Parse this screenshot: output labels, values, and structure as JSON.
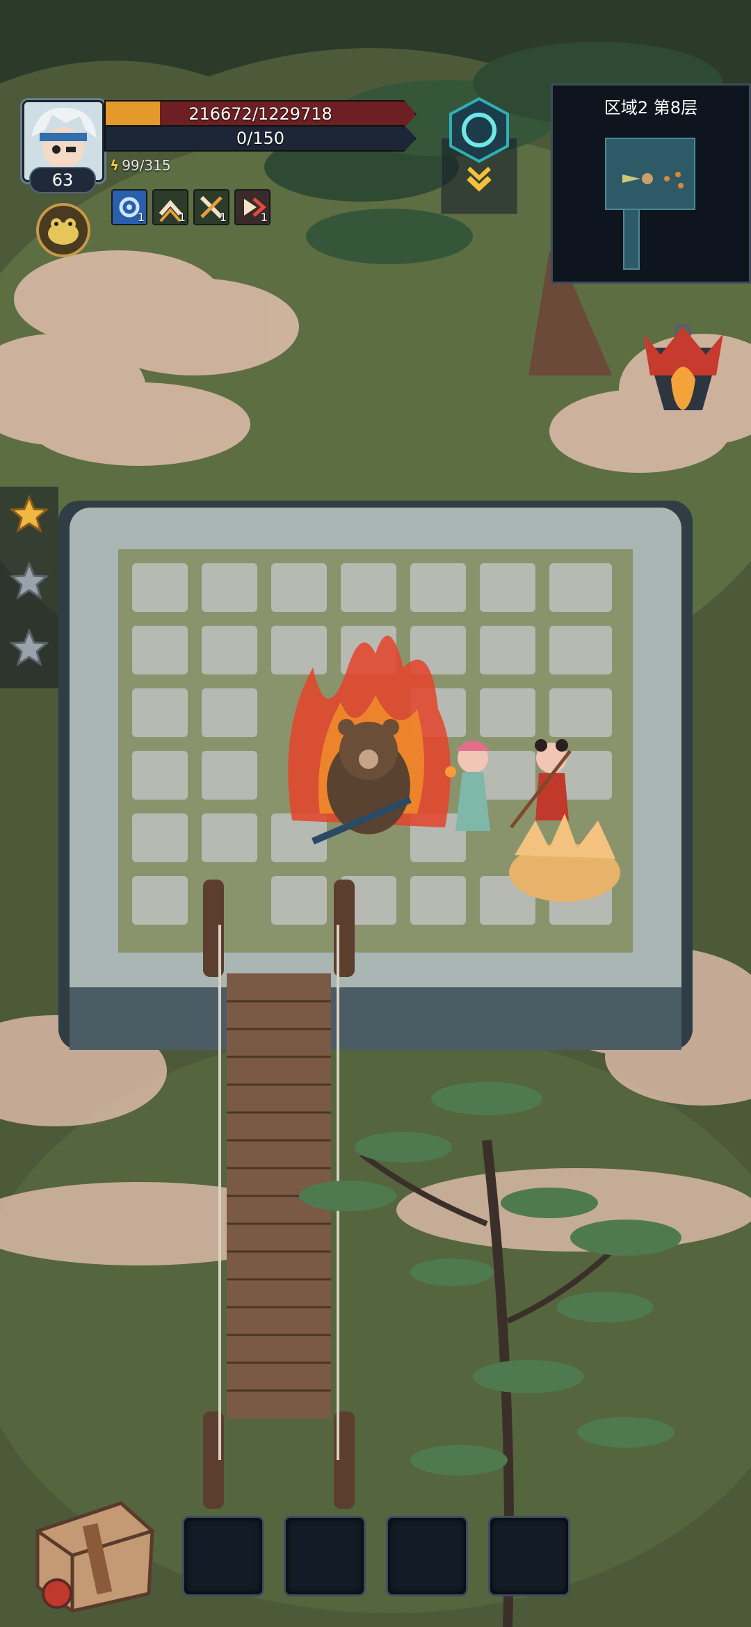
{
  "player": {
    "level": "63",
    "hp_text": "216672/1229718",
    "hp_fraction": 0.176,
    "xp_text": "0/150",
    "energy_text": "99/315"
  },
  "skills": [
    {
      "icon": "gear-skill-icon",
      "count": "1",
      "color": "#3a6fc2"
    },
    {
      "icon": "arrow-up-skill-icon",
      "count": "1",
      "color": "#2c3b2a"
    },
    {
      "icon": "cross-swords-skill-icon",
      "count": "1",
      "color": "#2c3b2a"
    },
    {
      "icon": "dash-skill-icon",
      "count": "1",
      "color": "#3a2a2a"
    }
  ],
  "minimap": {
    "title": "区域2 第8层"
  },
  "stars": [
    {
      "state": "active",
      "color": "#f0b840"
    },
    {
      "state": "inactive",
      "color": "#9aa2ab"
    },
    {
      "state": "inactive",
      "color": "#9aa2ab"
    }
  ],
  "inventory_slots": 4,
  "colors": {
    "hp_fill": "#e39a2a",
    "hp_bg": "#6d1f23",
    "xp_bg": "#1c2636",
    "accent_teal": "#2fb0b5"
  }
}
